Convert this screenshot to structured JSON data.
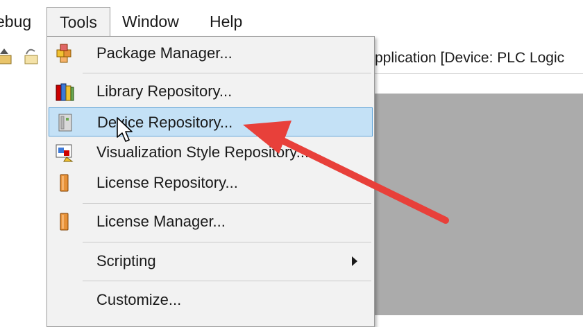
{
  "menubar": {
    "items": [
      {
        "label": "ebug"
      },
      {
        "label": "Tools"
      },
      {
        "label": "Window"
      },
      {
        "label": "Help"
      }
    ]
  },
  "titlebar": {
    "text": "pplication [Device: PLC Logic"
  },
  "tools_menu": {
    "items": [
      {
        "label": "Package Manager...",
        "icon": "package-icon"
      },
      {
        "label": "Library Repository...",
        "icon": "books-icon"
      },
      {
        "label": "Device Repository...",
        "icon": "device-icon",
        "highlighted": true
      },
      {
        "label": "Visualization Style Repository...",
        "icon": "visualization-icon"
      },
      {
        "label": "License Repository...",
        "icon": "license-icon"
      },
      {
        "label": "License Manager...",
        "icon": "license-icon"
      },
      {
        "label": "Scripting",
        "icon": "",
        "has_submenu": true
      },
      {
        "label": "Customize...",
        "icon": ""
      }
    ]
  },
  "colors": {
    "highlight": "#c4e1f6",
    "highlight_border": "#5fa4d9",
    "annotation_arrow": "#e8403a",
    "workspace": "#ababab"
  }
}
